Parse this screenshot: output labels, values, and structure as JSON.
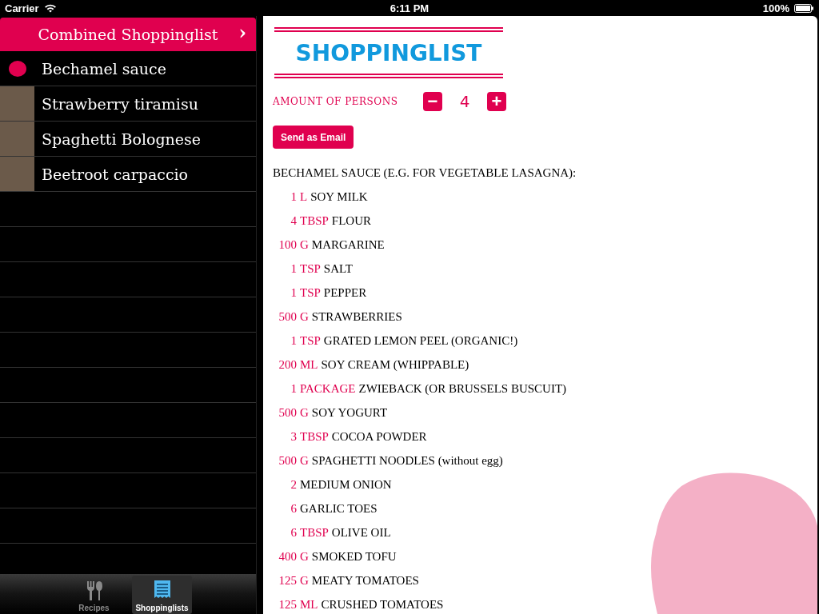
{
  "status_bar": {
    "carrier": "Carrier",
    "time": "6:11 PM",
    "battery": "100%"
  },
  "sidebar": {
    "header": "Combined Shoppinglist",
    "header_chevron": "›",
    "items": [
      {
        "name": "Bechamel sauce",
        "kind": "blot"
      },
      {
        "name": "Strawberry tiramisu",
        "kind": "photo"
      },
      {
        "name": "Spaghetti Bolognese",
        "kind": "photo"
      },
      {
        "name": "Beetroot carpaccio",
        "kind": "photo"
      }
    ]
  },
  "tab_bar": {
    "tabs": [
      {
        "label": "Recipes",
        "kind": "cutlery",
        "selected": false
      },
      {
        "label": "Shoppinglists",
        "kind": "list",
        "selected": true
      }
    ]
  },
  "content": {
    "logo": "SHOPPINGLIST",
    "persons_label": "AMOUNT OF PERSONS",
    "persons_count": "4",
    "minus": "−",
    "plus": "+",
    "email_button": "Send as Email",
    "section_title": "BECHAMEL SAUCE (E.G. FOR VEGETABLE LASAGNA):",
    "ingredients": [
      {
        "qty": "1",
        "unit": "L",
        "name": "SOY MILK"
      },
      {
        "qty": "4",
        "unit": "TBSP",
        "name": "FLOUR"
      },
      {
        "qty": "100",
        "unit": "G",
        "name": "MARGARINE"
      },
      {
        "qty": "1",
        "unit": "TSP",
        "name": "SALT"
      },
      {
        "qty": "1",
        "unit": "TSP",
        "name": "PEPPER"
      },
      {
        "qty": "500",
        "unit": "G",
        "name": "STRAWBERRIES"
      },
      {
        "qty": "1",
        "unit": "TSP",
        "name": "GRATED LEMON PEEL (ORGANIC!)"
      },
      {
        "qty": "200",
        "unit": "ML",
        "name": "SOY CREAM (WHIPPABLE)"
      },
      {
        "qty": "1",
        "unit": "PACKAGE",
        "name": "ZWIEBACK (OR BRUSSELS BUSCUIT)"
      },
      {
        "qty": "500",
        "unit": "G",
        "name": "SOY YOGURT"
      },
      {
        "qty": "3",
        "unit": "TBSP",
        "name": "COCOA POWDER"
      },
      {
        "qty": "500",
        "unit": "G",
        "name": "SPAGHETTI NOODLES (without egg)"
      },
      {
        "qty": "2",
        "name": "MEDIUM ONION"
      },
      {
        "qty": "6",
        "name": "GARLIC TOES"
      },
      {
        "qty": "6",
        "unit": "TBSP",
        "name": "OLIVE OIL"
      },
      {
        "qty": "400",
        "unit": "G",
        "name": "SMOKED TOFU"
      },
      {
        "qty": "125",
        "unit": "G",
        "name": "MEATY TOMATOES"
      },
      {
        "qty": "125",
        "unit": "ML",
        "name": "CRUSHED TOMATOES"
      }
    ]
  }
}
